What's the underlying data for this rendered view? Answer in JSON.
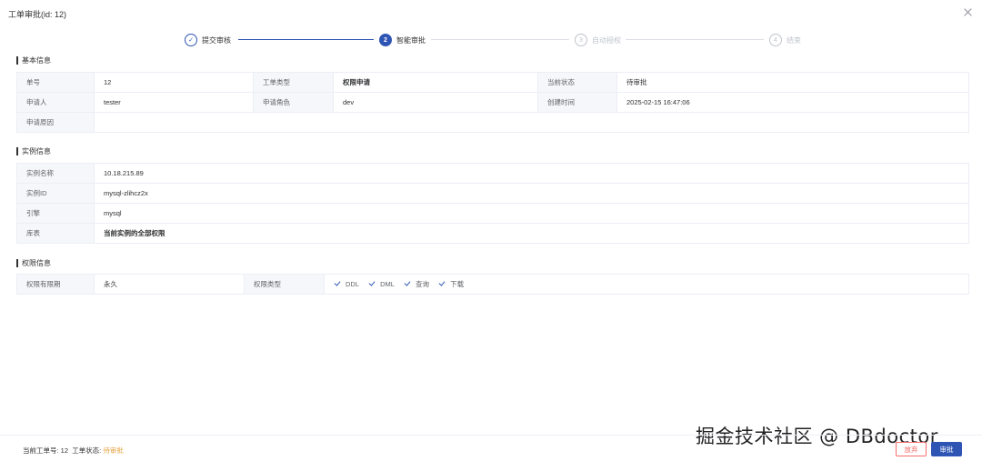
{
  "dialog": {
    "title": "工单审批(id: 12)"
  },
  "steps": [
    {
      "num": "✓",
      "label": "提交审核",
      "state": "done"
    },
    {
      "num": "2",
      "label": "智能审批",
      "state": "active"
    },
    {
      "num": "3",
      "label": "自动授权",
      "state": "pending"
    },
    {
      "num": "4",
      "label": "结束",
      "state": "pending"
    }
  ],
  "basic": {
    "title": "基本信息",
    "order_no_label": "单号",
    "order_no": "12",
    "type_label": "工单类型",
    "type": "权限申请",
    "status_label": "当前状态",
    "status": "待审批",
    "applicant_label": "申请人",
    "applicant": "tester",
    "role_label": "申请角色",
    "role": "dev",
    "created_label": "创建时间",
    "created": "2025-02-15 16:47:06",
    "reason_label": "申请原因",
    "reason": ""
  },
  "instance": {
    "title": "实例信息",
    "name_label": "实例名称",
    "name": "10.18.215.89",
    "id_label": "实例ID",
    "id": "mysql-zlihcz2x",
    "engine_label": "引擎",
    "engine": "mysql",
    "db_label": "库表",
    "db": "当前实例的全部权限"
  },
  "permission": {
    "title": "权限信息",
    "validity_label": "权限有限期",
    "validity": "永久",
    "ptype_label": "权限类型",
    "types": [
      "DDL",
      "DML",
      "查询",
      "下载"
    ]
  },
  "footer": {
    "order_prefix": "当前工单号: 12",
    "status_prefix": "工单状态: ",
    "status_value": "待审批",
    "abandon_label": "放弃",
    "approve_label": "审批"
  },
  "watermark": "掘金技术社区 @ DBdoctor",
  "colors": {
    "primary": "#2f55b4",
    "warning": "#e6a23c",
    "danger": "#f56c6c"
  }
}
